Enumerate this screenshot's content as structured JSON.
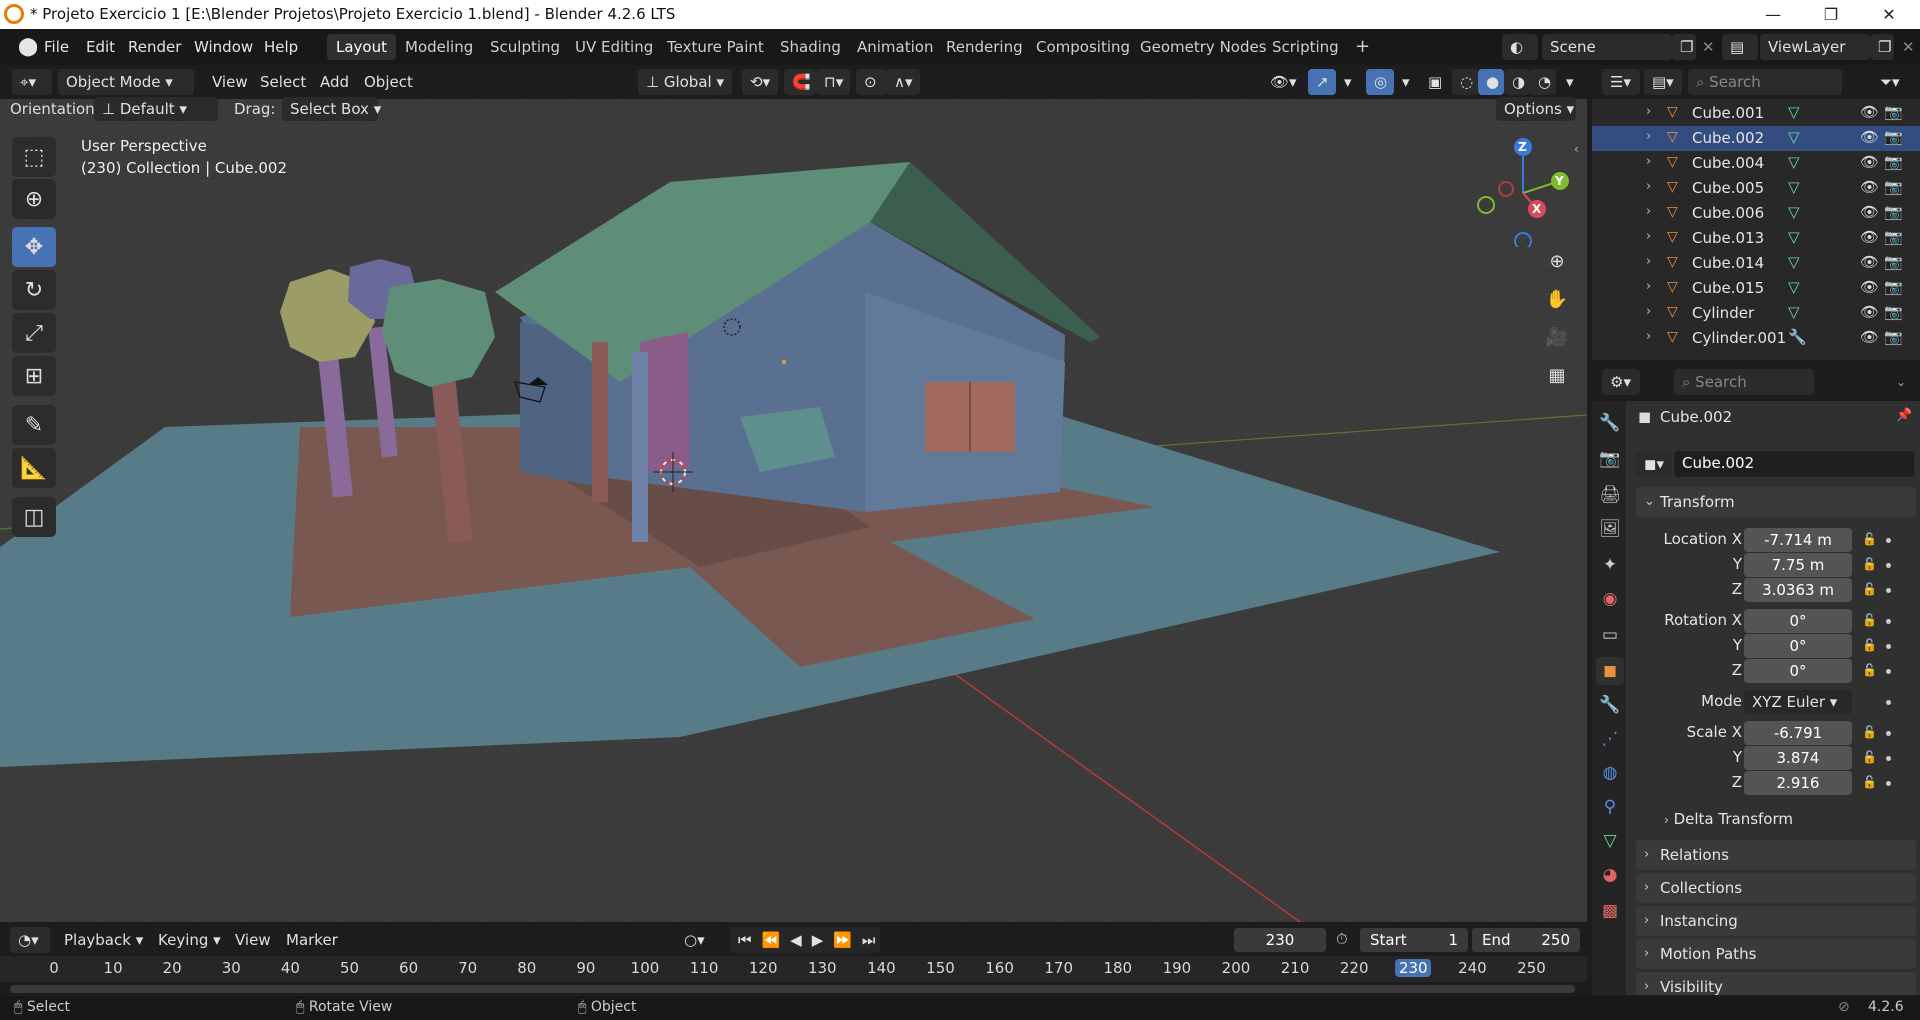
{
  "window": {
    "title": "* Projeto Exercicio 1 [E:\\Blender Projetos\\Projeto Exercicio 1.blend] - Blender 4.2.6 LTS",
    "minimize": "—",
    "maximize": "❐",
    "close": "✕"
  },
  "menus": [
    "File",
    "Edit",
    "Render",
    "Window",
    "Help"
  ],
  "workspaces": [
    "Layout",
    "Modeling",
    "Sculpting",
    "UV Editing",
    "Texture Paint",
    "Shading",
    "Animation",
    "Rendering",
    "Compositing",
    "Geometry Nodes",
    "Scripting"
  ],
  "active_workspace": "Layout",
  "scene": {
    "name": "Scene",
    "view_layer": "ViewLayer"
  },
  "viewport_header": {
    "mode": "Object Mode",
    "menus": [
      "View",
      "Select",
      "Add",
      "Object"
    ],
    "transform_orientation": "Global",
    "orientation_label": "Orientation:",
    "orientation_value": "Default",
    "drag_label": "Drag:",
    "drag_value": "Select Box",
    "options": "Options"
  },
  "viewport": {
    "perspective": "User Perspective",
    "collection_info": "(230) Collection | Cube.002",
    "gizmo": {
      "z": "Z",
      "y": "Y",
      "x": "X"
    }
  },
  "outliner": {
    "search_placeholder": "Search",
    "items": [
      {
        "name": "Cube.001",
        "selected": false,
        "mod": "mesh"
      },
      {
        "name": "Cube.002",
        "selected": true,
        "mod": "mesh"
      },
      {
        "name": "Cube.004",
        "selected": false,
        "mod": "mesh"
      },
      {
        "name": "Cube.005",
        "selected": false,
        "mod": "mesh"
      },
      {
        "name": "Cube.006",
        "selected": false,
        "mod": "mesh"
      },
      {
        "name": "Cube.013",
        "selected": false,
        "mod": "mesh"
      },
      {
        "name": "Cube.014",
        "selected": false,
        "mod": "mesh"
      },
      {
        "name": "Cube.015",
        "selected": false,
        "mod": "mesh"
      },
      {
        "name": "Cylinder",
        "selected": false,
        "mod": "mesh"
      },
      {
        "name": "Cylinder.001",
        "selected": false,
        "mod": "wrench"
      }
    ]
  },
  "properties": {
    "search_placeholder": "Search",
    "object_name": "Cube.002",
    "object_field": "Cube.002",
    "transform_label": "Transform",
    "location": {
      "label_x": "Location X",
      "x": "-7.714 m",
      "y": "7.75 m",
      "z": "3.0363 m"
    },
    "rotation": {
      "label_x": "Rotation X",
      "x": "0°",
      "y": "0°",
      "z": "0°"
    },
    "mode_label": "Mode",
    "mode_value": "XYZ Euler",
    "scale": {
      "label_x": "Scale X",
      "x": "-6.791",
      "y": "3.874",
      "z": "2.916"
    },
    "axis_y": "Y",
    "axis_z": "Z",
    "delta_transform": "Delta Transform",
    "panels": [
      "Relations",
      "Collections",
      "Instancing",
      "Motion Paths",
      "Visibility"
    ]
  },
  "timeline": {
    "menus": [
      "Playback",
      "Keying",
      "View",
      "Marker"
    ],
    "current_frame": "230",
    "start_label": "Start",
    "start_value": "1",
    "end_label": "End",
    "end_value": "250",
    "ruler": [
      "0",
      "10",
      "20",
      "30",
      "40",
      "50",
      "60",
      "70",
      "80",
      "90",
      "100",
      "110",
      "120",
      "130",
      "140",
      "150",
      "160",
      "170",
      "180",
      "190",
      "200",
      "210",
      "220",
      "230",
      "240",
      "250"
    ],
    "current_index": 23
  },
  "status": {
    "select": "Select",
    "rotate": "Rotate View",
    "object": "Object",
    "version": "4.2.6"
  },
  "colors": {
    "accent": "#4772b3",
    "roof": "#5e8e77",
    "wall": "#5a7090",
    "ground_blue": "#577c88",
    "ground_brown": "#7a5852",
    "object_orange": "#e8913e"
  }
}
